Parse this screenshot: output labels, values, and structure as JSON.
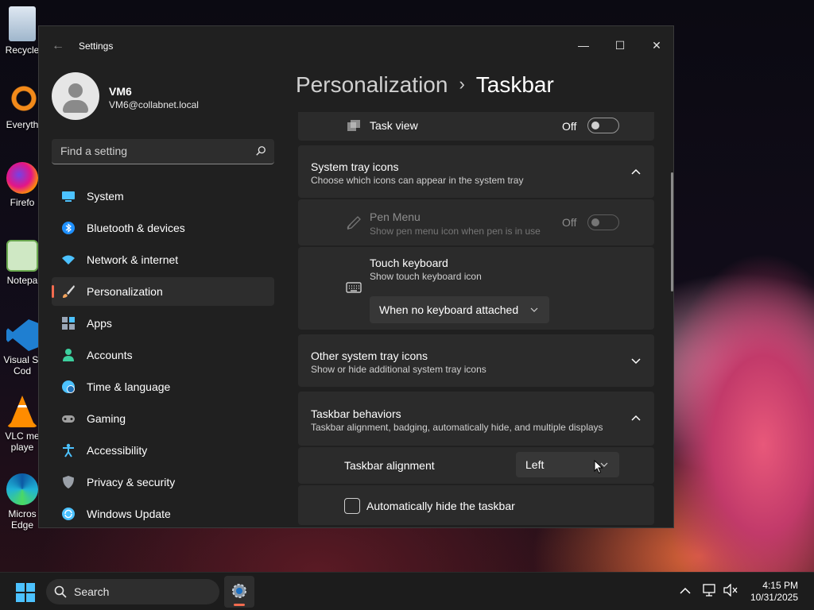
{
  "desktop": {
    "icons": [
      {
        "label": "Recycle",
        "icon": "recycle-bin-icon"
      },
      {
        "label": "Everyth",
        "icon": "everything-search-icon"
      },
      {
        "label": "Firefo",
        "icon": "firefox-icon"
      },
      {
        "label": "Notepa",
        "icon": "notepad-icon"
      },
      {
        "label": "Visual St Cod",
        "icon": "vscode-icon"
      },
      {
        "label": "VLC me playe",
        "icon": "vlc-icon"
      },
      {
        "label": "Micros Edge",
        "icon": "edge-icon"
      }
    ]
  },
  "window": {
    "title": "Settings",
    "controls": {
      "minimize": "—",
      "maximize": "☐",
      "close": "✕"
    }
  },
  "profile": {
    "name": "VM6",
    "email": "VM6@collabnet.local"
  },
  "search": {
    "placeholder": "Find a setting"
  },
  "sidebar": {
    "items": [
      {
        "label": "System",
        "icon": "system-icon",
        "color": "#4cc2ff"
      },
      {
        "label": "Bluetooth & devices",
        "icon": "bluetooth-icon",
        "color": "#1e90ff"
      },
      {
        "label": "Network & internet",
        "icon": "wifi-icon",
        "color": "#4cc2ff"
      },
      {
        "label": "Personalization",
        "icon": "brush-icon",
        "color": "#f2a35c",
        "active": true
      },
      {
        "label": "Apps",
        "icon": "apps-icon",
        "color": "#9aa7b8"
      },
      {
        "label": "Accounts",
        "icon": "accounts-icon",
        "color": "#3ccf9e"
      },
      {
        "label": "Time & language",
        "icon": "globe-clock-icon",
        "color": "#4cc2ff"
      },
      {
        "label": "Gaming",
        "icon": "gamepad-icon",
        "color": "#a0a0a0"
      },
      {
        "label": "Accessibility",
        "icon": "accessibility-icon",
        "color": "#4cc2ff"
      },
      {
        "label": "Privacy & security",
        "icon": "shield-icon",
        "color": "#9aa0a8"
      },
      {
        "label": "Windows Update",
        "icon": "update-icon",
        "color": "#4cc2ff"
      }
    ]
  },
  "breadcrumb": {
    "parent": "Personalization",
    "separator": "›",
    "current": "Taskbar"
  },
  "content": {
    "task_view": {
      "label": "Task view",
      "state": "Off"
    },
    "system_tray": {
      "title": "System tray icons",
      "subtitle": "Choose which icons can appear in the system tray",
      "pen_menu": {
        "title": "Pen Menu",
        "subtitle": "Show pen menu icon when pen is in use",
        "state": "Off"
      },
      "touch_keyboard": {
        "title": "Touch keyboard",
        "subtitle": "Show touch keyboard icon",
        "dropdown_value": "When no keyboard attached"
      }
    },
    "other_tray": {
      "title": "Other system tray icons",
      "subtitle": "Show or hide additional system tray icons"
    },
    "behaviors": {
      "title": "Taskbar behaviors",
      "subtitle": "Taskbar alignment, badging, automatically hide, and multiple displays",
      "alignment_label": "Taskbar alignment",
      "alignment_value": "Left",
      "autohide_label": "Automatically hide the taskbar",
      "autohide_checked": false
    }
  },
  "taskbar": {
    "search_label": "Search",
    "time": "4:15 PM",
    "date": "10/31/2025"
  },
  "colors": {
    "accent": "#f26b4f",
    "window_bg": "#202020",
    "card_bg": "#2b2b2b"
  }
}
